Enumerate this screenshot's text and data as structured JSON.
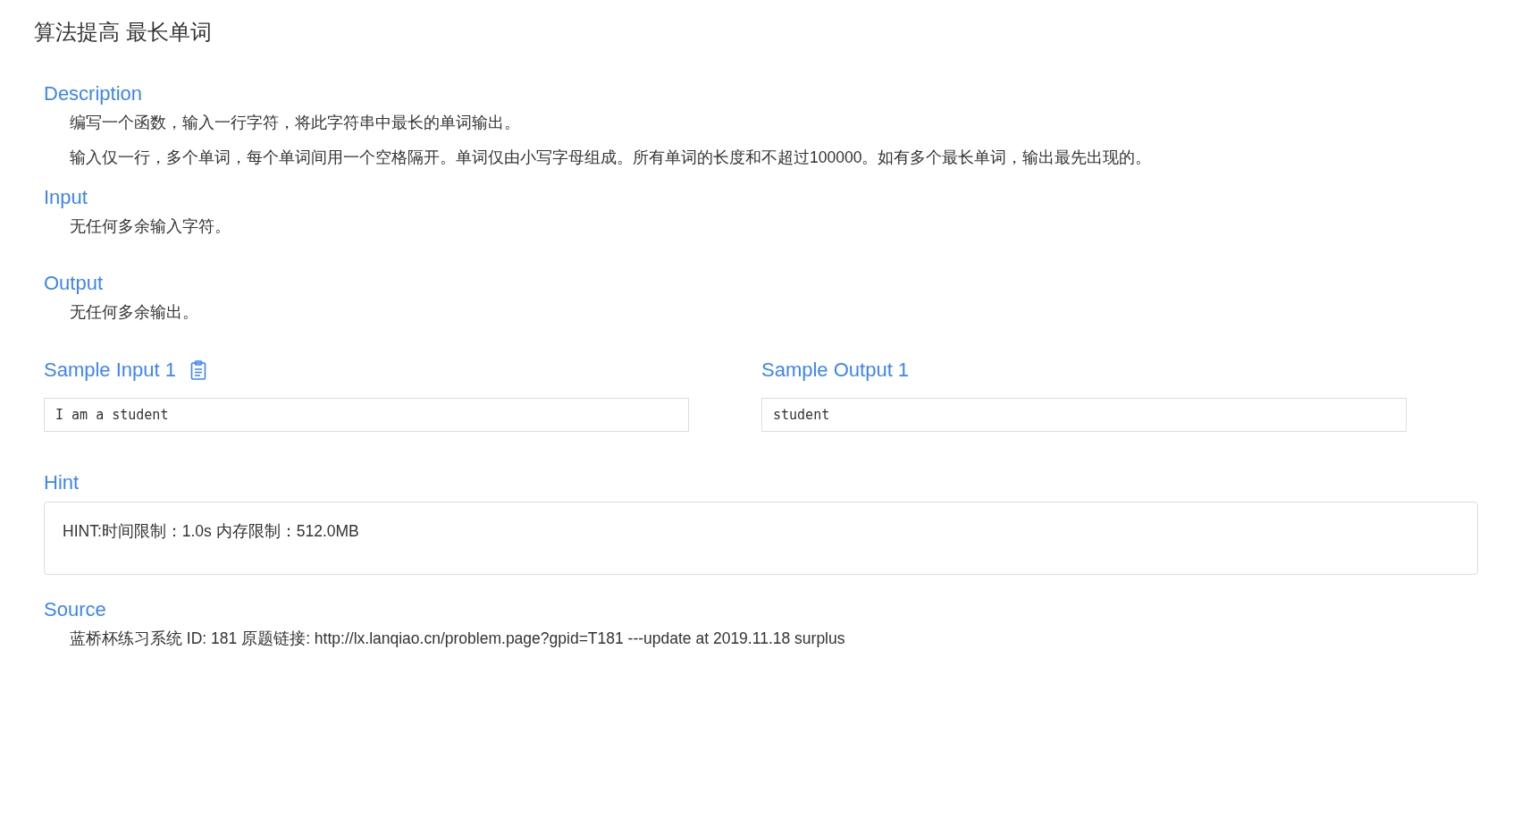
{
  "title": "算法提高 最长单词",
  "sections": [
    {
      "kind": "text",
      "heading": "Description",
      "paragraphs": [
        "编写一个函数，输入一行字符，将此字符串中最长的单词输出。",
        "输入仅一行，多个单词，每个单词间用一个空格隔开。单词仅由小写字母组成。所有单词的长度和不超过100000。如有多个最长单词，输出最先出现的。"
      ]
    },
    {
      "kind": "text",
      "heading": "Input",
      "paragraphs": [
        "无任何多余输入字符。"
      ]
    },
    {
      "kind": "text",
      "heading": "Output",
      "paragraphs": [
        "无任何多余输出。"
      ]
    },
    {
      "kind": "samples",
      "input": {
        "heading": "Sample Input 1",
        "code": "I am a student"
      },
      "output": {
        "heading": "Sample Output 1",
        "code": "student"
      }
    },
    {
      "kind": "box",
      "heading": "Hint",
      "paragraphs": [
        "HINT:时间限制：1.0s 内存限制：512.0MB"
      ]
    },
    {
      "kind": "text",
      "heading": "Source",
      "paragraphs": [
        "蓝桥杯练习系统 ID: 181 原题链接: http://lx.lanqiao.cn/problem.page?gpid=T181 ---update at 2019.11.18 surplus"
      ]
    }
  ]
}
